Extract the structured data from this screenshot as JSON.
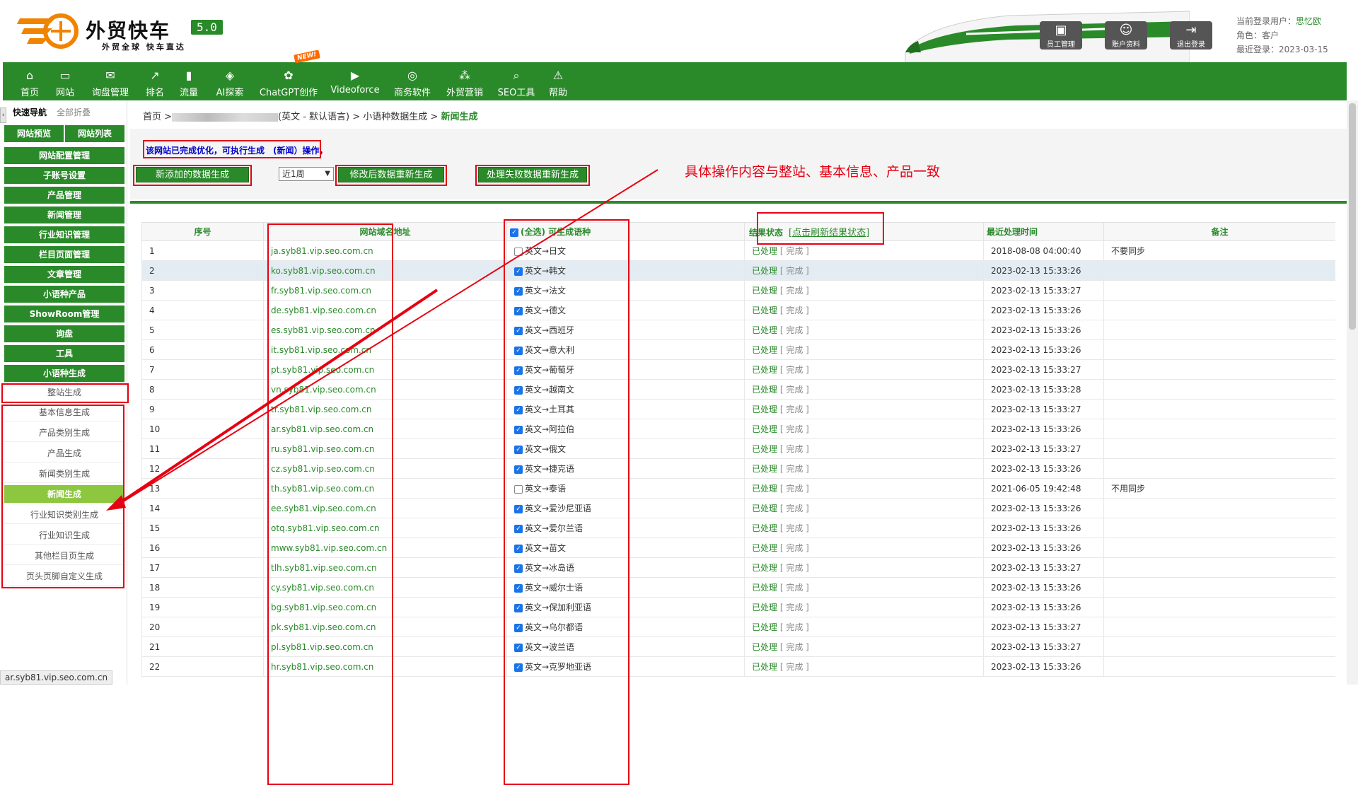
{
  "brand": {
    "name": "外贸快车",
    "version": "5.0",
    "slogan": "外贸全球 快车直达"
  },
  "top_buttons": [
    {
      "label": "员工管理",
      "icon": "staff-icon"
    },
    {
      "label": "账户资料",
      "icon": "account-icon"
    },
    {
      "label": "退出登录",
      "icon": "logout-icon"
    }
  ],
  "user": {
    "current_label": "当前登录用户：",
    "current_name": "思忆欧",
    "role_label": "角色：客户",
    "last_login_label": "最近登录：2023-03-15"
  },
  "nav": [
    {
      "label": "首页",
      "icon": "home-icon"
    },
    {
      "label": "网站",
      "icon": "monitor-icon"
    },
    {
      "label": "询盘管理",
      "icon": "mail-icon"
    },
    {
      "label": "排名",
      "icon": "ranking-icon"
    },
    {
      "label": "流量",
      "icon": "bar-chart-icon"
    },
    {
      "label": "AI探索",
      "icon": "ai-icon"
    },
    {
      "label": "ChatGPT创作",
      "icon": "chatgpt-icon",
      "badge": "NEW!"
    },
    {
      "label": "Videoforce",
      "icon": "video-icon"
    },
    {
      "label": "商务软件",
      "icon": "software-icon"
    },
    {
      "label": "外贸营销",
      "icon": "marketing-icon"
    },
    {
      "label": "SEO工具",
      "icon": "search-icon"
    },
    {
      "label": "帮助",
      "icon": "warning-icon"
    }
  ],
  "sidebar": {
    "quick_nav": "快速导航",
    "collapse_all": "全部折叠",
    "preview": "网站预览",
    "site_list": "网站列表",
    "groups": [
      "网站配置管理",
      "子账号设置",
      "产品管理",
      "新闻管理",
      "行业知识管理",
      "栏目页面管理",
      "文章管理",
      "小语种产品",
      "ShowRoom管理",
      "询盘",
      "工具",
      "小语种生成"
    ],
    "whole_site": "整站生成",
    "sub_items": [
      "基本信息生成",
      "产品类别生成",
      "产品生成",
      "新闻类别生成",
      "新闻生成",
      "行业知识类别生成",
      "行业知识生成",
      "其他栏目页生成",
      "页头页脚自定义生成"
    ]
  },
  "breadcrumb": {
    "home": "首页 >",
    "lang": "(英文 - 默认语言) > 小语种数据生成 >",
    "current": "新闻生成"
  },
  "notice": "该网站已完成优化，可执行生成　(新闻）操作，",
  "actions": {
    "new_data": "新添加的数据生成",
    "period": "近1周",
    "regen_modified": "修改后数据重新生成",
    "handle_failed": "处理失败数据重新生成"
  },
  "annotation": "具体操作内容与整站、基本信息、产品一致",
  "table": {
    "headers": {
      "seq": "序号",
      "domain": "网站域名地址",
      "select_all": "(全选)",
      "lang": "可生成语种",
      "status": "结果状态",
      "refresh": "[点击刷新结果状态]",
      "time": "最近处理时间",
      "note": "备注"
    },
    "rows": [
      {
        "seq": "1",
        "domain": "ja.syb81.vip.seo.com.cn",
        "checked": false,
        "lang": "英文→日文",
        "status": "已处理",
        "result": "[ 完成 ]",
        "time": "2018-08-08 04:00:40",
        "note": "不要同步"
      },
      {
        "seq": "2",
        "domain": "ko.syb81.vip.seo.com.cn",
        "checked": true,
        "lang": "英文→韩文",
        "status": "已处理",
        "result": "[ 完成 ]",
        "time": "2023-02-13 15:33:26",
        "note": ""
      },
      {
        "seq": "3",
        "domain": "fr.syb81.vip.seo.com.cn",
        "checked": true,
        "lang": "英文→法文",
        "status": "已处理",
        "result": "[ 完成 ]",
        "time": "2023-02-13 15:33:27",
        "note": ""
      },
      {
        "seq": "4",
        "domain": "de.syb81.vip.seo.com.cn",
        "checked": true,
        "lang": "英文→德文",
        "status": "已处理",
        "result": "[ 完成 ]",
        "time": "2023-02-13 15:33:26",
        "note": ""
      },
      {
        "seq": "5",
        "domain": "es.syb81.vip.seo.com.cn",
        "checked": true,
        "lang": "英文→西班牙",
        "status": "已处理",
        "result": "[ 完成 ]",
        "time": "2023-02-13 15:33:26",
        "note": ""
      },
      {
        "seq": "6",
        "domain": "it.syb81.vip.seo.com.cn",
        "checked": true,
        "lang": "英文→意大利",
        "status": "已处理",
        "result": "[ 完成 ]",
        "time": "2023-02-13 15:33:26",
        "note": ""
      },
      {
        "seq": "7",
        "domain": "pt.syb81.vip.seo.com.cn",
        "checked": true,
        "lang": "英文→葡萄牙",
        "status": "已处理",
        "result": "[ 完成 ]",
        "time": "2023-02-13 15:33:27",
        "note": ""
      },
      {
        "seq": "8",
        "domain": "vn.syb81.vip.seo.com.cn",
        "checked": true,
        "lang": "英文→越南文",
        "status": "已处理",
        "result": "[ 完成 ]",
        "time": "2023-02-13 15:33:28",
        "note": ""
      },
      {
        "seq": "9",
        "domain": "tr.syb81.vip.seo.com.cn",
        "checked": true,
        "lang": "英文→土耳其",
        "status": "已处理",
        "result": "[ 完成 ]",
        "time": "2023-02-13 15:33:27",
        "note": ""
      },
      {
        "seq": "10",
        "domain": "ar.syb81.vip.seo.com.cn",
        "checked": true,
        "lang": "英文→阿拉伯",
        "status": "已处理",
        "result": "[ 完成 ]",
        "time": "2023-02-13 15:33:26",
        "note": ""
      },
      {
        "seq": "11",
        "domain": "ru.syb81.vip.seo.com.cn",
        "checked": true,
        "lang": "英文→俄文",
        "status": "已处理",
        "result": "[ 完成 ]",
        "time": "2023-02-13 15:33:27",
        "note": ""
      },
      {
        "seq": "12",
        "domain": "cz.syb81.vip.seo.com.cn",
        "checked": true,
        "lang": "英文→捷克语",
        "status": "已处理",
        "result": "[ 完成 ]",
        "time": "2023-02-13 15:33:26",
        "note": ""
      },
      {
        "seq": "13",
        "domain": "th.syb81.vip.seo.com.cn",
        "checked": false,
        "lang": "英文→泰语",
        "status": "已处理",
        "result": "[ 完成 ]",
        "time": "2021-06-05 19:42:48",
        "note": "不用同步"
      },
      {
        "seq": "14",
        "domain": "ee.syb81.vip.seo.com.cn",
        "checked": true,
        "lang": "英文→爱沙尼亚语",
        "status": "已处理",
        "result": "[ 完成 ]",
        "time": "2023-02-13 15:33:26",
        "note": ""
      },
      {
        "seq": "15",
        "domain": "otq.syb81.vip.seo.com.cn",
        "checked": true,
        "lang": "英文→爱尔兰语",
        "status": "已处理",
        "result": "[ 完成 ]",
        "time": "2023-02-13 15:33:26",
        "note": ""
      },
      {
        "seq": "16",
        "domain": "mww.syb81.vip.seo.com.cn",
        "checked": true,
        "lang": "英文→苗文",
        "status": "已处理",
        "result": "[ 完成 ]",
        "time": "2023-02-13 15:33:26",
        "note": ""
      },
      {
        "seq": "17",
        "domain": "tlh.syb81.vip.seo.com.cn",
        "checked": true,
        "lang": "英文→冰岛语",
        "status": "已处理",
        "result": "[ 完成 ]",
        "time": "2023-02-13 15:33:27",
        "note": ""
      },
      {
        "seq": "18",
        "domain": "cy.syb81.vip.seo.com.cn",
        "checked": true,
        "lang": "英文→威尔士语",
        "status": "已处理",
        "result": "[ 完成 ]",
        "time": "2023-02-13 15:33:26",
        "note": ""
      },
      {
        "seq": "19",
        "domain": "bg.syb81.vip.seo.com.cn",
        "checked": true,
        "lang": "英文→保加利亚语",
        "status": "已处理",
        "result": "[ 完成 ]",
        "time": "2023-02-13 15:33:26",
        "note": ""
      },
      {
        "seq": "20",
        "domain": "pk.syb81.vip.seo.com.cn",
        "checked": true,
        "lang": "英文→乌尔都语",
        "status": "已处理",
        "result": "[ 完成 ]",
        "time": "2023-02-13 15:33:27",
        "note": ""
      },
      {
        "seq": "21",
        "domain": "pl.syb81.vip.seo.com.cn",
        "checked": true,
        "lang": "英文→波兰语",
        "status": "已处理",
        "result": "[ 完成 ]",
        "time": "2023-02-13 15:33:27",
        "note": ""
      },
      {
        "seq": "22",
        "domain": "hr.syb81.vip.seo.com.cn",
        "checked": true,
        "lang": "英文→克罗地亚语",
        "status": "已处理",
        "result": "[ 完成 ]",
        "time": "2023-02-13 15:33:26",
        "note": ""
      }
    ]
  },
  "status_bar": "ar.syb81.vip.seo.com.cn",
  "colors": {
    "primary_green": "#2a8a2a",
    "active_green": "#8dc63f",
    "annotation_red": "#e60012",
    "notice_blue": "#0000cc",
    "logo_orange": "#f08300"
  }
}
